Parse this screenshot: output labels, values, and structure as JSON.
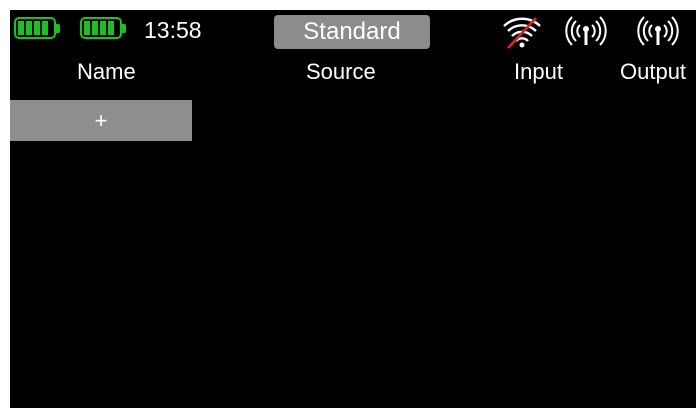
{
  "status_bar": {
    "clock": "13:58",
    "battery_1_icon": "battery-full-icon",
    "battery_2_icon": "battery-full-icon",
    "wifi_icon": "wifi-disabled-icon",
    "input_signal_icon": "antenna-signal-icon",
    "output_signal_icon": "antenna-signal-icon",
    "accent_color": "#19c31e",
    "disabled_color": "#e02020"
  },
  "mode": {
    "label": "Standard"
  },
  "columns": {
    "name": "Name",
    "source": "Source",
    "input": "Input",
    "output": "Output"
  },
  "list": {
    "add_label": "+"
  }
}
